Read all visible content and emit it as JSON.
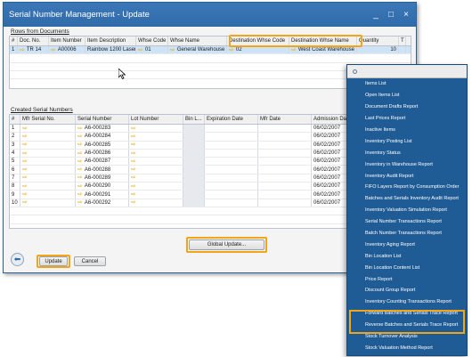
{
  "window": {
    "title": "Serial Number Management - Update",
    "controls": [
      "_",
      "□",
      "×"
    ]
  },
  "rows_from_documents": {
    "label": "Rows from Documents",
    "columns": [
      "#",
      "Doc. No.",
      "Item Number",
      "Item Description",
      "Whse Code",
      "Whse Name",
      "Destination Whse Code",
      "Destination Whse Name",
      "Quantity",
      "T"
    ],
    "rows": [
      {
        "num": "1",
        "doc": "TR 14",
        "item": "A00006",
        "desc": "Rainbow 1200 Laser",
        "whse": "01",
        "whse_name": "General Warehouse",
        "dst_code": "02",
        "dst_name": "West Coast Warehouse",
        "qty": "10"
      }
    ]
  },
  "created_serials": {
    "label": "Created Serial Numbers",
    "columns": [
      "#",
      "Mfr Serial No.",
      "Serial Number",
      "Lot Number",
      "Bin L...",
      "Expiration Date",
      "Mfr Date",
      "Admission Da"
    ],
    "rows": [
      {
        "num": "1",
        "serial": "A6-000283",
        "date": "06/02/2007"
      },
      {
        "num": "2",
        "serial": "A6-000284",
        "date": "06/02/2007"
      },
      {
        "num": "3",
        "serial": "A6-000285",
        "date": "06/02/2007"
      },
      {
        "num": "4",
        "serial": "A6-000286",
        "date": "06/02/2007"
      },
      {
        "num": "5",
        "serial": "A6-000287",
        "date": "06/02/2007"
      },
      {
        "num": "6",
        "serial": "A6-000288",
        "date": "06/02/2007"
      },
      {
        "num": "7",
        "serial": "A6-000289",
        "date": "06/02/2007"
      },
      {
        "num": "8",
        "serial": "A6-000290",
        "date": "06/02/2007"
      },
      {
        "num": "9",
        "serial": "A6-000291",
        "date": "06/02/2007"
      },
      {
        "num": "10",
        "serial": "A6-000292",
        "date": "06/02/2007"
      }
    ]
  },
  "buttons": {
    "global_update": "Global Update...",
    "update": "Update",
    "cancel": "Cancel"
  },
  "menu": {
    "items": [
      "Items List",
      "Open Items List",
      "Document Drafts Report",
      "Last Prices Report",
      "Inactive Items",
      "Inventory Posting List",
      "Inventory Status",
      "Inventory in Warehouse Report",
      "Inventory Audit Report",
      "FIFO Layers Report by Consumption Order",
      "Batches and Serials Inventory Audit Report",
      "Inventory Valuation Simulation Report",
      "Serial Number Transactions Report",
      "Batch Number Transactions Report",
      "Inventory Aging Report",
      "Bin Location List",
      "Bin Location Content List",
      "Price Report",
      "Discount Group Report",
      "Inventory Counting Transactions Report",
      "Forward Batches and Serials Trace Report",
      "Reverse Batches and Serials Trace Report",
      "Stock Turnover Analysis",
      "Stock Valuation Method Report"
    ]
  },
  "colors": {
    "accent_highlight": "#f2a516",
    "title_bar": "#2f6aa9",
    "menu_bg": "#1f5c96",
    "arrow_icon": "#e6a700"
  },
  "icons": {
    "row_link": "link-arrow-icon",
    "back": "back-arrow-icon",
    "menu_header": "circle-icon"
  }
}
